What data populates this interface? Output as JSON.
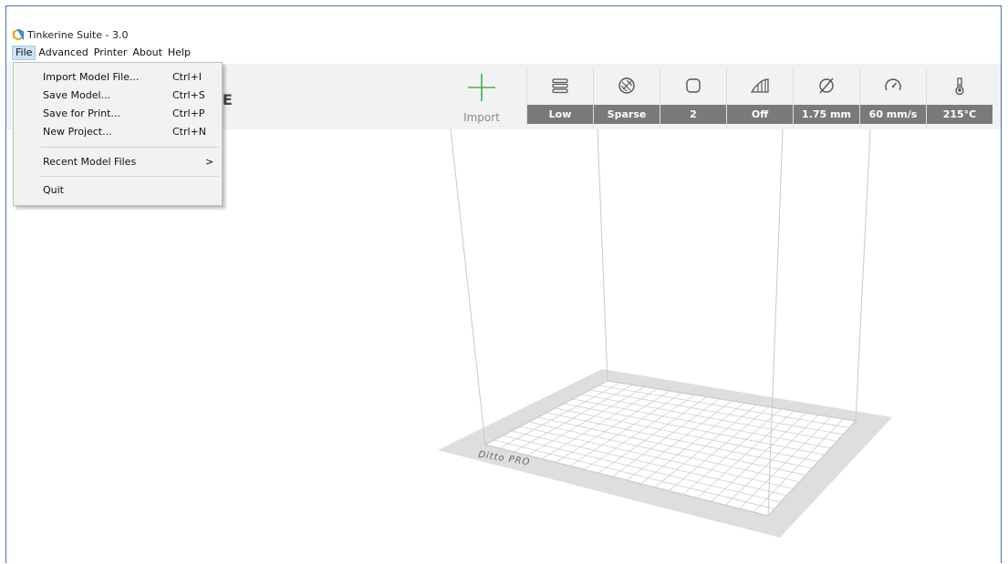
{
  "window": {
    "title": "Tinkerine Suite - 3.0"
  },
  "menubar": [
    "File",
    "Advanced",
    "Printer",
    "About",
    "Help"
  ],
  "file_menu": {
    "items": [
      {
        "label": "Import Model File...",
        "shortcut": "Ctrl+I"
      },
      {
        "label": "Save Model...",
        "shortcut": "Ctrl+S"
      },
      {
        "label": "Save for Print...",
        "shortcut": "Ctrl+P"
      },
      {
        "label": "New Project...",
        "shortcut": "Ctrl+N"
      },
      {
        "label": "Recent Model Files",
        "arrow": ">"
      },
      {
        "label": "Quit"
      }
    ]
  },
  "toolbar": {
    "brand_partial": "TE",
    "import_label": "Import",
    "settings": [
      {
        "icon": "layers-icon",
        "value": "Low"
      },
      {
        "icon": "infill-icon",
        "value": "Sparse"
      },
      {
        "icon": "shell-icon",
        "value": "2"
      },
      {
        "icon": "support-icon",
        "value": "Off"
      },
      {
        "icon": "diameter-icon",
        "value": "1.75 mm"
      },
      {
        "icon": "speed-icon",
        "value": "60 mm/s"
      },
      {
        "icon": "temperature-icon",
        "value": "215°C"
      }
    ]
  },
  "printer": {
    "bed_mark": "Ditto PRO"
  },
  "colors": {
    "accent_green": "#3cb44b",
    "value_bg": "#7a7a7a",
    "toolbar_bg": "#f2f2f2"
  }
}
